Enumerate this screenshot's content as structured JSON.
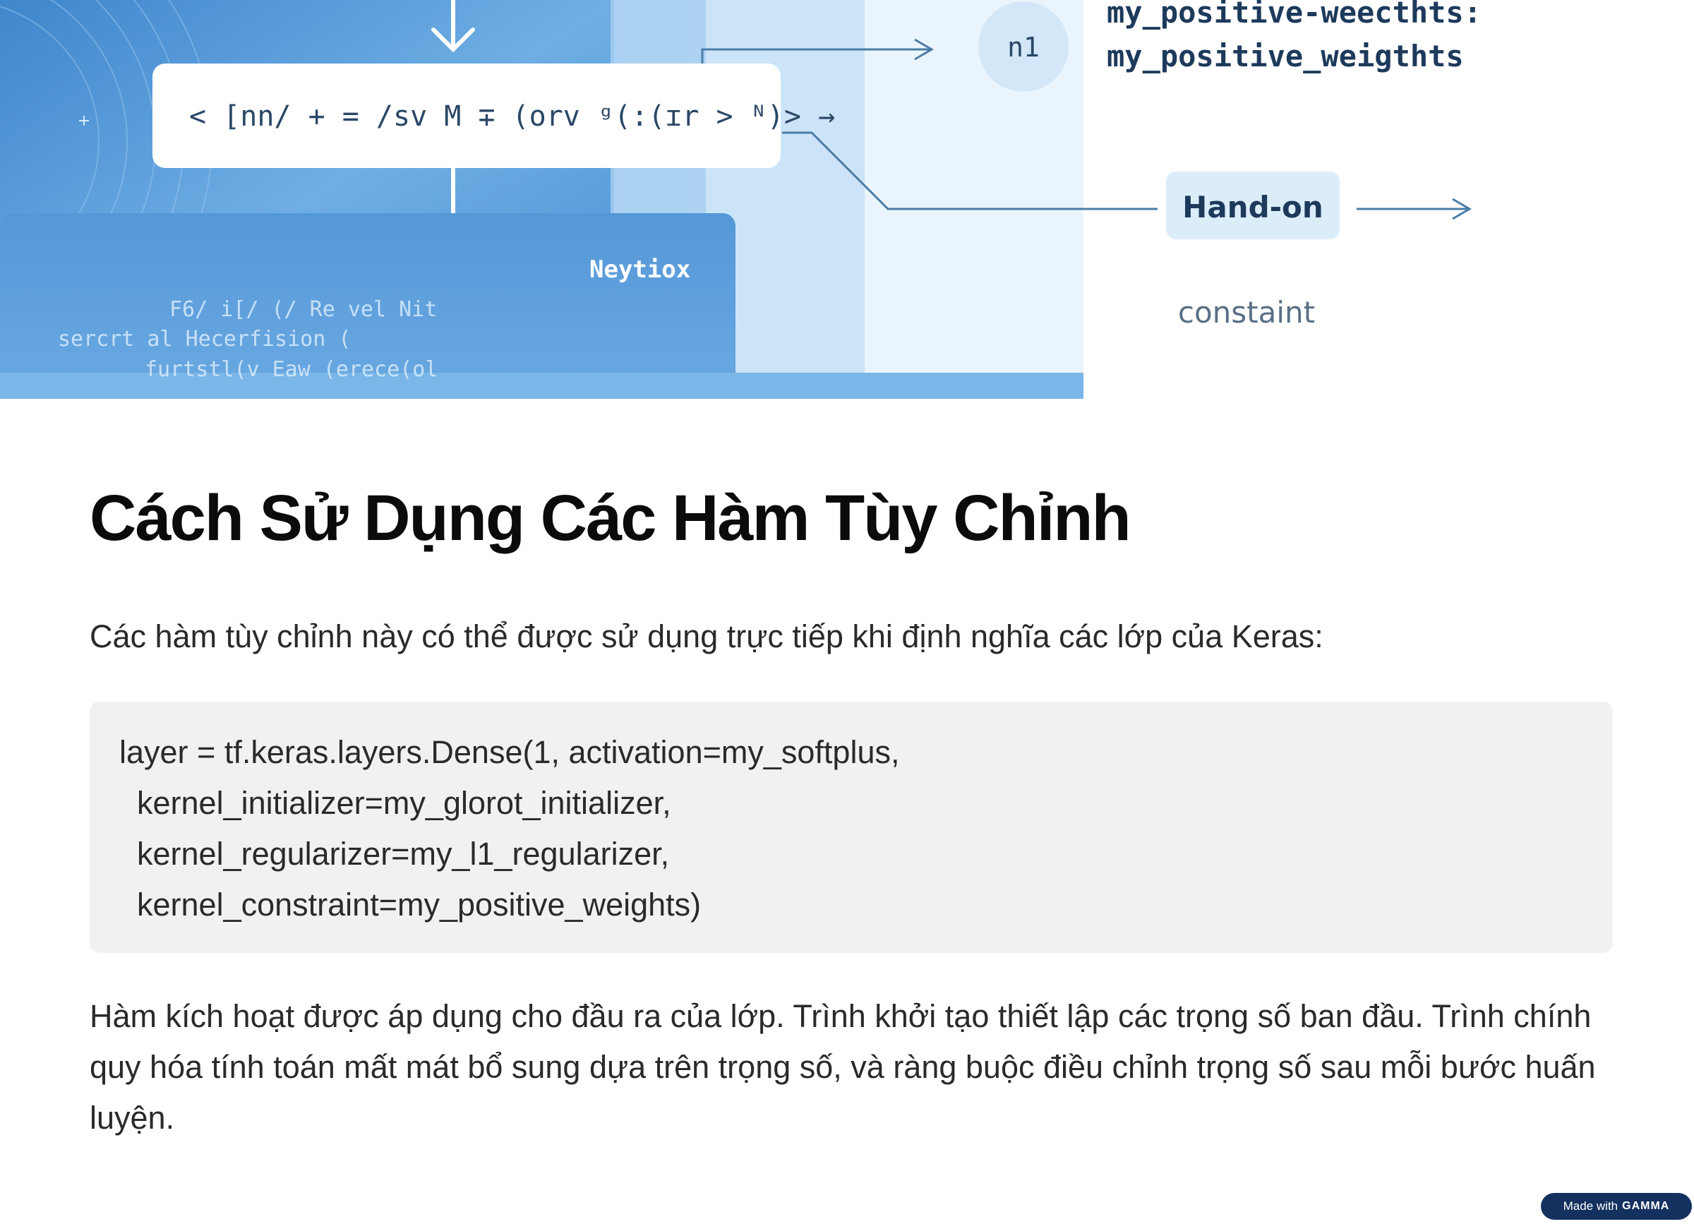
{
  "illustration": {
    "formula_text": "< [nn/ + = /sv M ∓ (orv ᵍ(:(ɪr > ᴺ)> →",
    "node_label": "n1",
    "weights_text_1": "my_positive-weecthts:",
    "weights_text_2": "my_positive_weigthts",
    "hand_on_label": "Hand-on",
    "constraint_label": "constaint",
    "panel_label": "Neytiox",
    "panel_line_1": "F6/ i[/ (/ Re vel Nit",
    "panel_line_2": "sercrt al Hecerfision (",
    "panel_line_3": "furtstl(v Eaw (erece(ol"
  },
  "section": {
    "title": "Cách Sử Dụng Các Hàm Tùy Chỉnh",
    "intro": "Các hàm tùy chỉnh này có thể được sử dụng trực tiếp khi định nghĩa các lớp của Keras:",
    "code_lines": [
      "layer = tf.keras.layers.Dense(1, activation=my_softplus,",
      "  kernel_initializer=my_glorot_initializer,",
      "  kernel_regularizer=my_l1_regularizer,",
      "  kernel_constraint=my_positive_weights)"
    ],
    "description": "Hàm kích hoạt được áp dụng cho đầu ra của lớp. Trình khởi tạo thiết lập các trọng số ban đầu. Trình chính quy hóa tính toán mất mát bổ sung dựa trên trọng số, và ràng buộc điều chỉnh trọng số sau mỗi bước huấn luyện."
  },
  "badge": {
    "prefix": "Made with",
    "brand": "GAMMA"
  },
  "colors": {
    "hero_blue": "#5d9fdb",
    "hero_light": "#d9ebf9",
    "badge_bg": "#13305f",
    "code_bg": "#f1f1f1"
  }
}
